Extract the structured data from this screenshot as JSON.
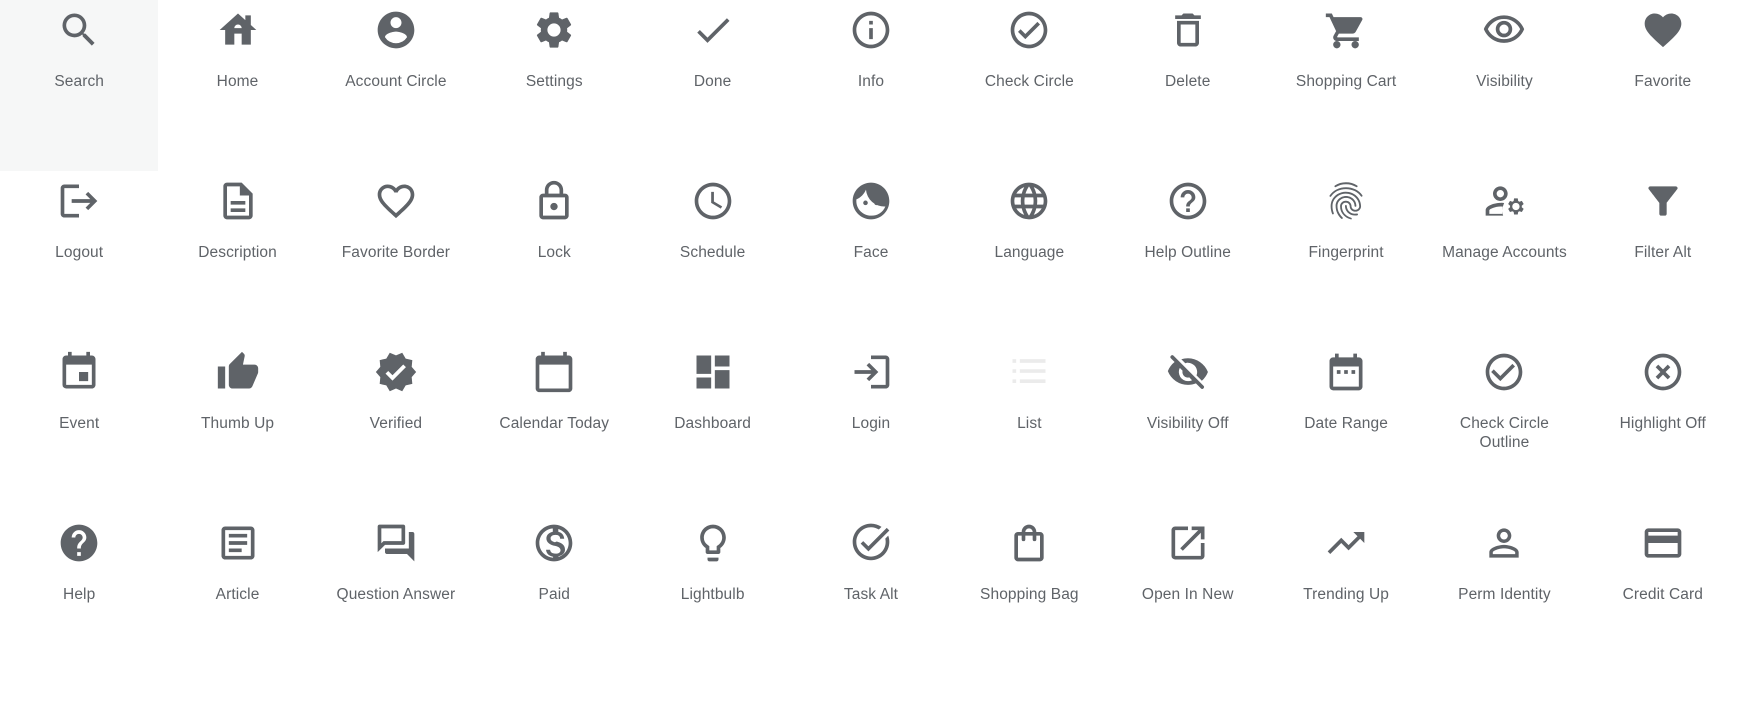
{
  "page": {
    "title": "Material Icon Gallery",
    "background_color": "#ffffff",
    "icon_color": "#5f6368",
    "label_color": "#5f6368",
    "hover_background": "#f6f7f7",
    "faded_icon_color": "#ebebeb",
    "columns": 11,
    "rows": 4
  },
  "icons": [
    {
      "label": "Search",
      "icon": "search-icon",
      "state": "hovered"
    },
    {
      "label": "Home",
      "icon": "home-icon",
      "state": "normal"
    },
    {
      "label": "Account Circle",
      "icon": "account-circle-icon",
      "state": "normal"
    },
    {
      "label": "Settings",
      "icon": "settings-icon",
      "state": "normal"
    },
    {
      "label": "Done",
      "icon": "done-icon",
      "state": "normal"
    },
    {
      "label": "Info",
      "icon": "info-icon",
      "state": "normal"
    },
    {
      "label": "Check Circle",
      "icon": "check-circle-icon",
      "state": "normal"
    },
    {
      "label": "Delete",
      "icon": "delete-icon",
      "state": "normal"
    },
    {
      "label": "Shopping Cart",
      "icon": "shopping-cart-icon",
      "state": "normal"
    },
    {
      "label": "Visibility",
      "icon": "visibility-icon",
      "state": "normal"
    },
    {
      "label": "Favorite",
      "icon": "favorite-icon",
      "state": "normal"
    },
    {
      "label": "Logout",
      "icon": "logout-icon",
      "state": "normal"
    },
    {
      "label": "Description",
      "icon": "description-icon",
      "state": "normal"
    },
    {
      "label": "Favorite Border",
      "icon": "favorite-border-icon",
      "state": "normal"
    },
    {
      "label": "Lock",
      "icon": "lock-icon",
      "state": "normal"
    },
    {
      "label": "Schedule",
      "icon": "schedule-icon",
      "state": "normal"
    },
    {
      "label": "Face",
      "icon": "face-icon",
      "state": "normal"
    },
    {
      "label": "Language",
      "icon": "language-icon",
      "state": "normal"
    },
    {
      "label": "Help Outline",
      "icon": "help-outline-icon",
      "state": "normal"
    },
    {
      "label": "Fingerprint",
      "icon": "fingerprint-icon",
      "state": "normal"
    },
    {
      "label": "Manage Accounts",
      "icon": "manage-accounts-icon",
      "state": "normal"
    },
    {
      "label": "Filter Alt",
      "icon": "filter-alt-icon",
      "state": "normal"
    },
    {
      "label": "Event",
      "icon": "event-icon",
      "state": "normal"
    },
    {
      "label": "Thumb Up",
      "icon": "thumb-up-icon",
      "state": "normal"
    },
    {
      "label": "Verified",
      "icon": "verified-icon",
      "state": "normal"
    },
    {
      "label": "Calendar Today",
      "icon": "calendar-today-icon",
      "state": "normal"
    },
    {
      "label": "Dashboard",
      "icon": "dashboard-icon",
      "state": "normal"
    },
    {
      "label": "Login",
      "icon": "login-icon",
      "state": "normal"
    },
    {
      "label": "List",
      "icon": "list-icon",
      "state": "faded"
    },
    {
      "label": "Visibility Off",
      "icon": "visibility-off-icon",
      "state": "normal"
    },
    {
      "label": "Date Range",
      "icon": "date-range-icon",
      "state": "normal"
    },
    {
      "label": "Check Circle Outline",
      "icon": "check-circle-outline-icon",
      "state": "normal"
    },
    {
      "label": "Highlight Off",
      "icon": "highlight-off-icon",
      "state": "normal"
    },
    {
      "label": "Help",
      "icon": "help-icon",
      "state": "normal"
    },
    {
      "label": "Article",
      "icon": "article-icon",
      "state": "normal"
    },
    {
      "label": "Question Answer",
      "icon": "question-answer-icon",
      "state": "normal"
    },
    {
      "label": "Paid",
      "icon": "paid-icon",
      "state": "normal"
    },
    {
      "label": "Lightbulb",
      "icon": "lightbulb-icon",
      "state": "normal"
    },
    {
      "label": "Task Alt",
      "icon": "task-alt-icon",
      "state": "normal"
    },
    {
      "label": "Shopping Bag",
      "icon": "shopping-bag-icon",
      "state": "normal"
    },
    {
      "label": "Open In New",
      "icon": "open-in-new-icon",
      "state": "normal"
    },
    {
      "label": "Trending Up",
      "icon": "trending-up-icon",
      "state": "normal"
    },
    {
      "label": "Perm Identity",
      "icon": "perm-identity-icon",
      "state": "normal"
    },
    {
      "label": "Credit Card",
      "icon": "credit-card-icon",
      "state": "normal"
    }
  ]
}
